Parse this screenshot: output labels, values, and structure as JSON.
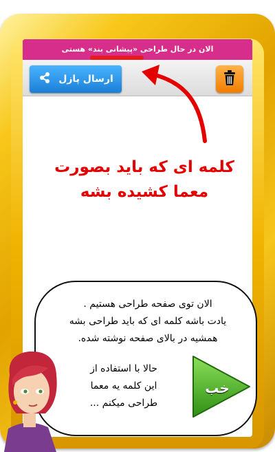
{
  "title_bar": {
    "text": "الان در حال طراحی «پیشانی بند» هستی"
  },
  "toolbar": {
    "send_label": "ارسال پازل",
    "share_icon": "share-icon",
    "trash_icon": "trash-icon"
  },
  "annotation": {
    "line1": "کلمه ای که باید بصورت",
    "line2": "معما کشیده بشه"
  },
  "bubble": {
    "line1": "الان توی صفحه طراحی هستیم .",
    "line2": "یادت باشه کلمه ای که باید طراحی بشه",
    "line3": "همشیه در بالای صفحه نوشته شده.",
    "line4": "حالا با استفاده از",
    "line5": "این کلمه یه معما",
    "line6": "طراحی میکنم ..."
  },
  "next_button": {
    "label": "خب"
  },
  "colors": {
    "title_bar": "#d62e8a",
    "send_button": "#2b95ea",
    "trash_button": "#f59a1b",
    "annotation": "#e50000",
    "next_button": "#3fae1f"
  }
}
